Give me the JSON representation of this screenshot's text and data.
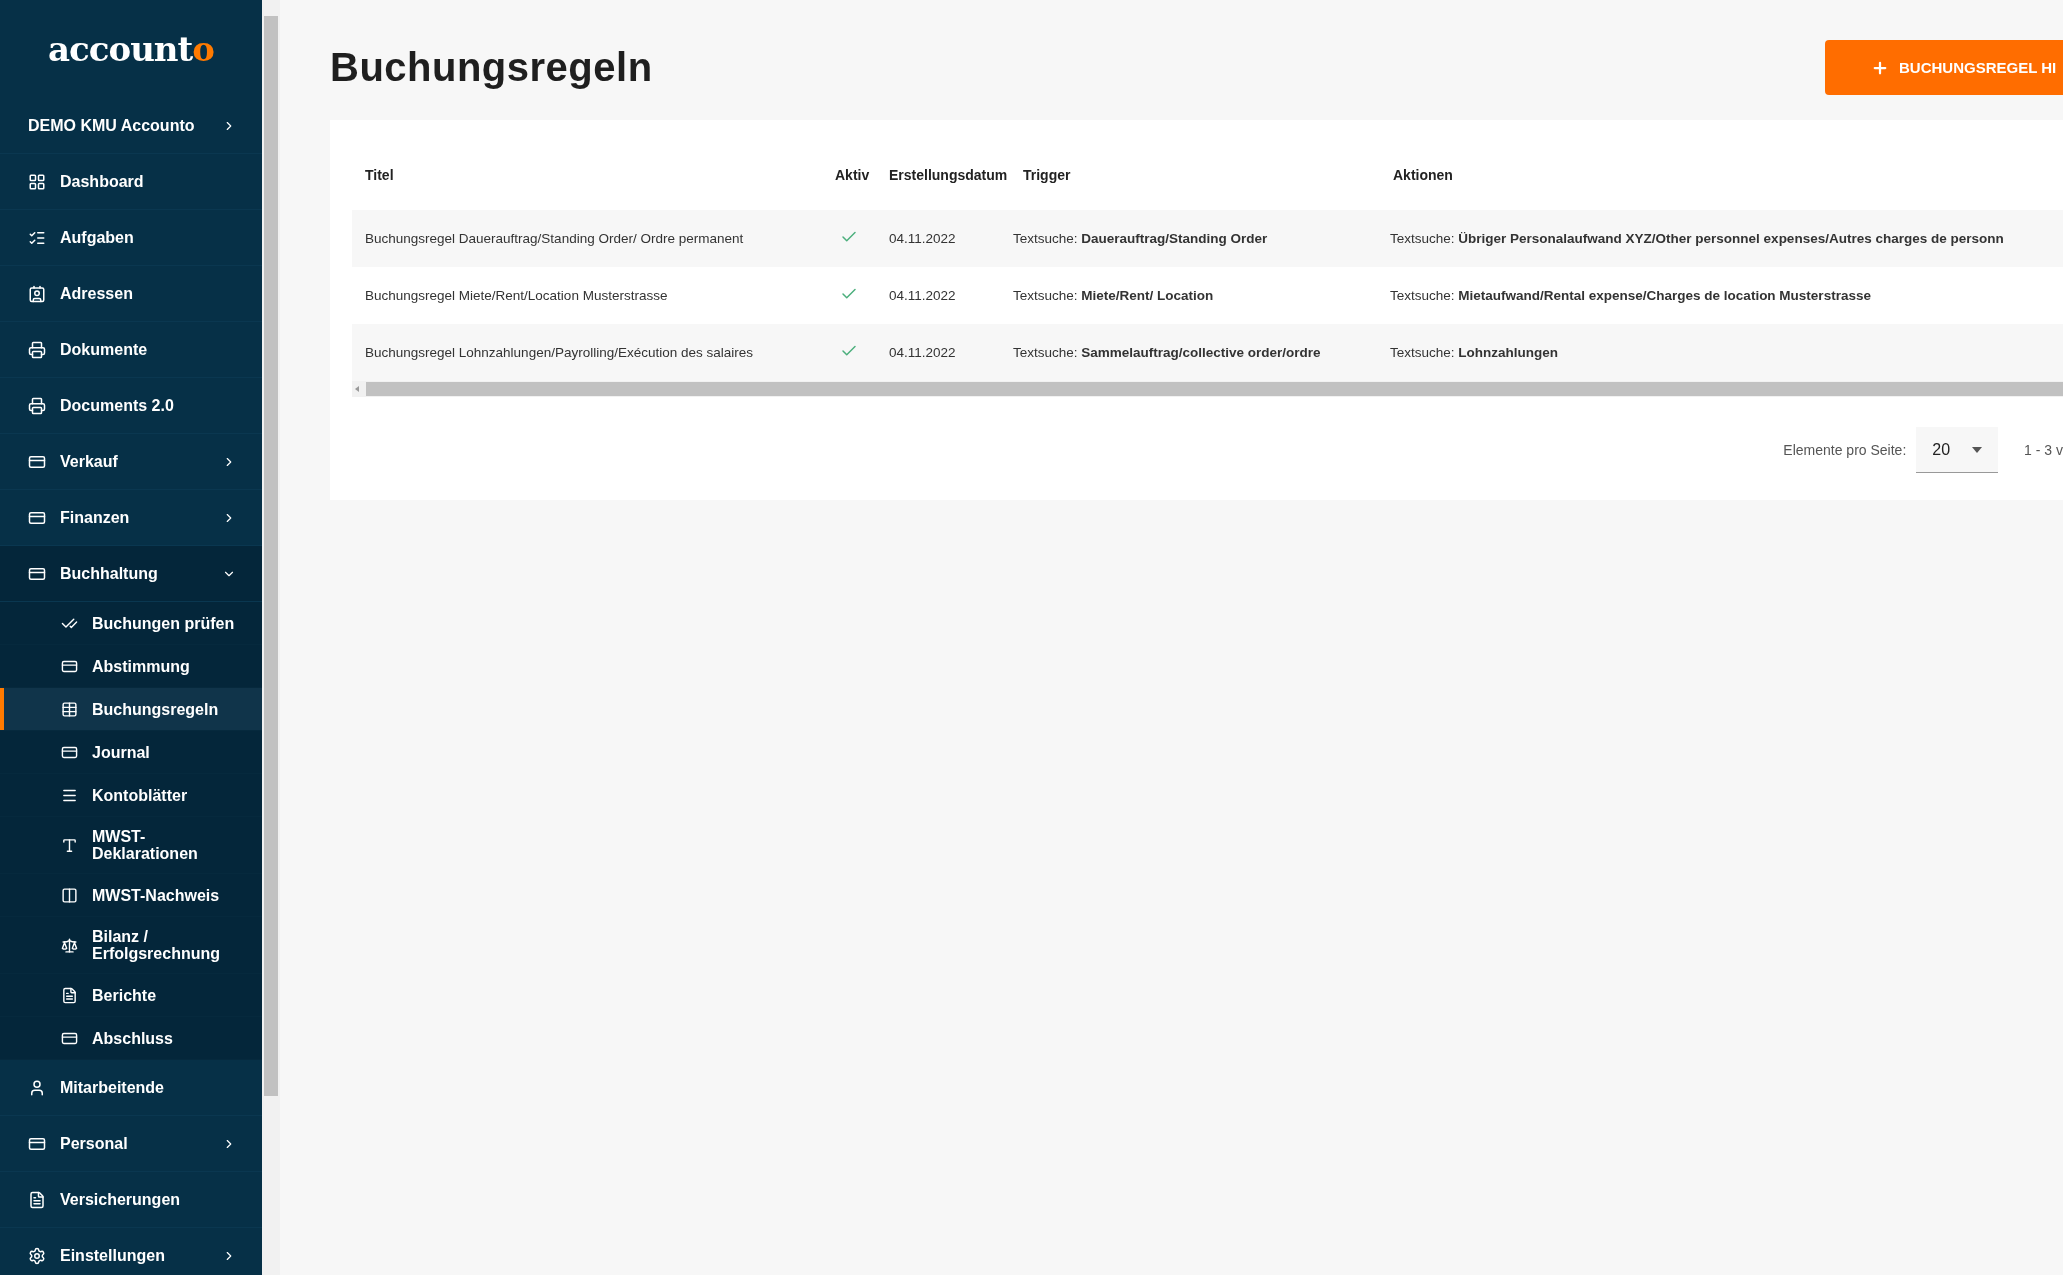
{
  "sidebar": {
    "logo": "accounto",
    "items": [
      {
        "kind": "group",
        "label": "DEMO KMU Accounto",
        "expanded": false,
        "selected": false
      },
      {
        "kind": "link",
        "label": "Dashboard",
        "selected": false
      },
      {
        "kind": "link",
        "label": "Aufgaben",
        "selected": false
      },
      {
        "kind": "link",
        "label": "Adressen",
        "selected": false
      },
      {
        "kind": "link",
        "label": "Dokumente",
        "selected": false
      },
      {
        "kind": "link",
        "label": "Documents 2.0",
        "selected": false
      },
      {
        "kind": "group",
        "label": "Verkauf",
        "expanded": false,
        "selected": false
      },
      {
        "kind": "group",
        "label": "Finanzen",
        "expanded": false,
        "selected": false
      },
      {
        "kind": "group",
        "label": "Buchhaltung",
        "expanded": true,
        "selected": false,
        "children": [
          {
            "label": "Buchungen prüfen",
            "selected": false
          },
          {
            "label": "Abstimmung",
            "selected": false
          },
          {
            "label": "Buchungsregeln",
            "selected": true
          },
          {
            "label": "Journal",
            "selected": false
          },
          {
            "label": "Kontoblätter",
            "selected": false
          },
          {
            "label": "MWST-\nDeklarationen",
            "selected": false
          },
          {
            "label": "MWST-Nachweis",
            "selected": false
          },
          {
            "label": "Bilanz /\nErfolgsrechnung",
            "selected": false
          },
          {
            "label": "Berichte",
            "selected": false
          },
          {
            "label": "Abschluss",
            "selected": false
          }
        ]
      },
      {
        "kind": "link",
        "label": "Mitarbeitende",
        "selected": false
      },
      {
        "kind": "group",
        "label": "Personal",
        "expanded": false,
        "selected": false
      },
      {
        "kind": "link",
        "label": "Versicherungen",
        "selected": false
      },
      {
        "kind": "group",
        "label": "Einstellungen",
        "expanded": false,
        "selected": false
      }
    ]
  },
  "page": {
    "title": "Buchungsregeln",
    "add_button": "BUCHUNGSREGEL HI"
  },
  "table": {
    "columns": [
      "Titel",
      "Aktiv",
      "Erstellungsdatum",
      "Trigger",
      "Aktionen"
    ],
    "rows": [
      {
        "title": "Buchungsregel Dauerauftrag/Standing Order/ Ordre permanent",
        "active": true,
        "date": "04.11.2022",
        "trigger": "Textsuche: **Dauerauftrag/Standing Order**",
        "action": "Textsuche: **Übriger Personalaufwand XYZ/Other personnel expenses/Autres charges de personn**"
      },
      {
        "title": "Buchungsregel Miete/Rent/Location Musterstrasse",
        "active": true,
        "date": "04.11.2022",
        "trigger": "Textsuche: **Miete/Rent/ Location**",
        "action": "Textsuche: **Mietaufwand/Rental expense/Charges de location Musterstrasse**"
      },
      {
        "title": "Buchungsregel Lohnzahlungen/Payrolling/Exécution des salaires",
        "active": true,
        "date": "04.11.2022",
        "trigger": "Textsuche: **Sammelauftrag/collective order/ordre**",
        "action": "Textsuche: **Lohnzahlungen**"
      }
    ]
  },
  "pagination": {
    "label": "Elemente pro Seite:",
    "page_size": "20",
    "range": "1 - 3 v"
  }
}
